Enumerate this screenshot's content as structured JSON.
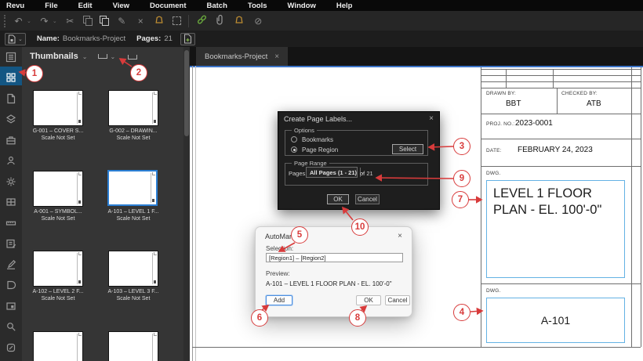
{
  "menu_bar": {
    "items": [
      "Revu",
      "File",
      "Edit",
      "View",
      "Document",
      "Batch",
      "Tools",
      "Window",
      "Help"
    ]
  },
  "toolbar": {
    "icons": [
      "drag-handle",
      "undo-icon",
      "undo-dropdown-chevron",
      "redo-icon",
      "redo-dropdown-chevron",
      "cut-icon",
      "copy-icon",
      "paste-icon",
      "format-painter-icon",
      "delete-icon",
      "flag-icon",
      "snapshot-crop-icon",
      "hyperlink-icon",
      "attachment-icon",
      "flag-icon-2",
      "no-link-icon"
    ]
  },
  "file_bar": {
    "name_label": "Name:",
    "name_value": "Bookmarks-Project",
    "pages_label": "Pages:",
    "pages_value": "21"
  },
  "sidebar": {
    "icons": [
      "properties-icon",
      "thumbnails-icon",
      "bookmarks-icon",
      "layers-icon",
      "toolbox-icon",
      "studio-icon",
      "spaces-icon",
      "windows-icon",
      "measurements-icon",
      "markups-icon",
      "signatures-icon",
      "forms-icon",
      "media-icon",
      "search-icon",
      "links-icon"
    ],
    "selected": "thumbnails-icon"
  },
  "thumbnails_panel": {
    "title": "Thumbnails",
    "items": [
      {
        "label": "G-001 – COVER S...",
        "scale": "Scale Not Set"
      },
      {
        "label": "G-002 – DRAWIN...",
        "scale": "Scale Not Set"
      },
      {
        "label": "A-001 – SYMBOL...",
        "scale": "Scale Not Set"
      },
      {
        "label": "A-101 – LEVEL 1 F...",
        "scale": "Scale Not Set",
        "selected": true
      },
      {
        "label": "A-102 – LEVEL 2 F...",
        "scale": "Scale Not Set"
      },
      {
        "label": "A-103 – LEVEL 3 F...",
        "scale": "Scale Not Set"
      }
    ]
  },
  "tab_bar": {
    "active_tab": "Bookmarks-Project",
    "close": "×"
  },
  "document": {
    "title_block": {
      "drawn_by_label": "DRAWN BY:",
      "drawn_by": "BBT",
      "checked_by_label": "CHECKED BY:",
      "checked_by": "ATB",
      "proj_no_label": "PROJ. NO.:",
      "proj_no": "2023-0001",
      "date_label": "DATE:",
      "date": "FEBRUARY 24, 2023",
      "dwg_label_1": "DWG.",
      "dwg_title": "LEVEL 1 FLOOR PLAN - EL. 100'-0\"",
      "dwg_label_2": "DWG.",
      "dwg_number": "A-101"
    }
  },
  "dialogs": {
    "create_page_labels": {
      "title": "Create Page Labels...",
      "close": "×",
      "options_group": "Options",
      "radio_bookmarks": "Bookmarks",
      "radio_page_region": "Page Region",
      "select_button": "Select",
      "page_range_group": "Page Range",
      "pages_label": "Pages:",
      "pages_value": "All Pages (1 - 21)",
      "of_pages": "of 21",
      "ok": "OK",
      "cancel": "Cancel"
    },
    "automark": {
      "title": "AutoMark",
      "close": "×",
      "selection_label": "Selection:",
      "selection_value": "[Region1] – [Region2]",
      "preview_label": "Preview:",
      "preview_value": "A-101 – LEVEL 1 FLOOR PLAN - EL. 100'-0\"",
      "add": "Add",
      "ok": "OK",
      "cancel": "Cancel"
    }
  },
  "callouts": {
    "color": "#d83b3b",
    "items": [
      {
        "n": "1"
      },
      {
        "n": "2"
      },
      {
        "n": "3"
      },
      {
        "n": "4"
      },
      {
        "n": "5"
      },
      {
        "n": "6"
      },
      {
        "n": "7"
      },
      {
        "n": "8"
      },
      {
        "n": "9"
      },
      {
        "n": "10"
      }
    ]
  }
}
